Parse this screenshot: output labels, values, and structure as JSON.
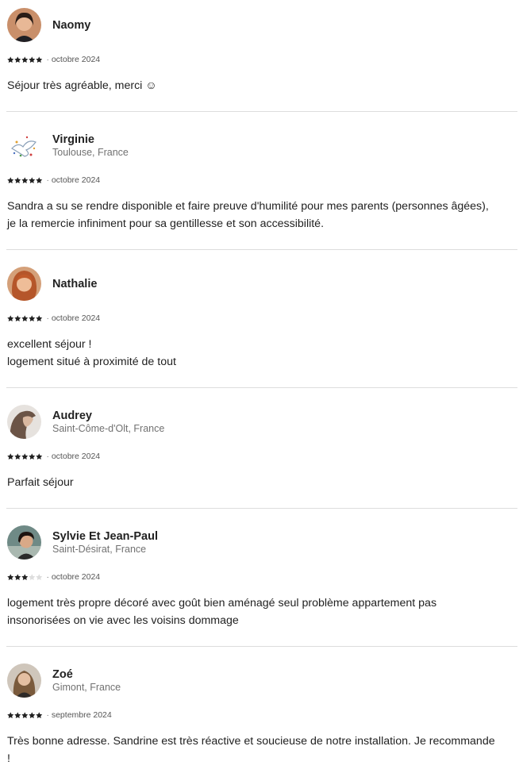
{
  "reviews": [
    {
      "name": "Naomy",
      "location": "",
      "stars": 5,
      "separator": "·",
      "date": "octobre 2024",
      "text": "Séjour très agréable, merci ☺"
    },
    {
      "name": "Virginie",
      "location": "Toulouse, France",
      "stars": 5,
      "separator": "·",
      "date": "octobre 2024",
      "text": "Sandra a su se rendre disponible et faire preuve d'humilité pour mes parents (personnes âgées),\nje la remercie infiniment pour sa gentillesse et son accessibilité."
    },
    {
      "name": "Nathalie",
      "location": "",
      "stars": 5,
      "separator": "·",
      "date": "octobre 2024",
      "text": "excellent séjour !\nlogement situé à proximité de tout"
    },
    {
      "name": "Audrey",
      "location": "Saint-Côme-d'Olt, France",
      "stars": 5,
      "separator": "·",
      "date": "octobre 2024",
      "text": "Parfait séjour"
    },
    {
      "name": "Sylvie Et Jean-Paul",
      "location": "Saint-Désirat, France",
      "stars": 3,
      "separator": "·",
      "date": "octobre 2024",
      "text": "logement très propre décoré avec goût bien aménagé seul problème appartement pas\ninsonorisées on vie avec les voisins dommage"
    },
    {
      "name": "Zoé",
      "location": "Gimont, France",
      "stars": 5,
      "separator": "·",
      "date": "septembre 2024",
      "text": "Très bonne adresse. Sandrine est très réactive et soucieuse de notre installation. Je recommande\n!"
    }
  ],
  "colors": {
    "text": "#222222",
    "secondary": "#717171",
    "divider": "#dddddd",
    "star_filled": "#222222",
    "star_empty": "#dddddd"
  },
  "icons": {
    "star": "star-icon",
    "avatar": "avatar"
  }
}
